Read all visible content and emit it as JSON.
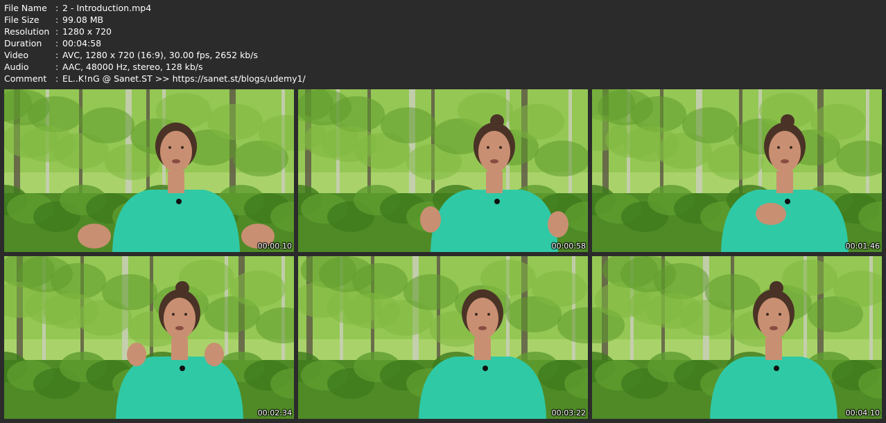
{
  "info": [
    {
      "label": "File Name",
      "value": "2 - Introduction.mp4"
    },
    {
      "label": "File Size",
      "value": "99.08 MB"
    },
    {
      "label": "Resolution",
      "value": "1280 x 720"
    },
    {
      "label": "Duration",
      "value": "00:04:58"
    },
    {
      "label": "Video",
      "value": "AVC, 1280 x 720 (16:9), 30.00 fps, 2652 kb/s"
    },
    {
      "label": "Audio",
      "value": "AAC, 48000 Hz, stereo, 128 kb/s"
    },
    {
      "label": "Comment",
      "value": "EL..K!nG @ Sanet.ST >> https://sanet.st/blogs/udemy1/"
    }
  ],
  "separator": ":",
  "thumbnails": [
    {
      "timestamp": "00:00:10"
    },
    {
      "timestamp": "00:00:58"
    },
    {
      "timestamp": "00:01:46"
    },
    {
      "timestamp": "00:02:34"
    },
    {
      "timestamp": "00:03:22"
    },
    {
      "timestamp": "00:04:10"
    }
  ],
  "colors": {
    "background": "#2b2b2b",
    "foliage": "#6fa63a",
    "shirt": "#2fc9a6",
    "skin": "#c98f72",
    "hair": "#4a3326"
  }
}
